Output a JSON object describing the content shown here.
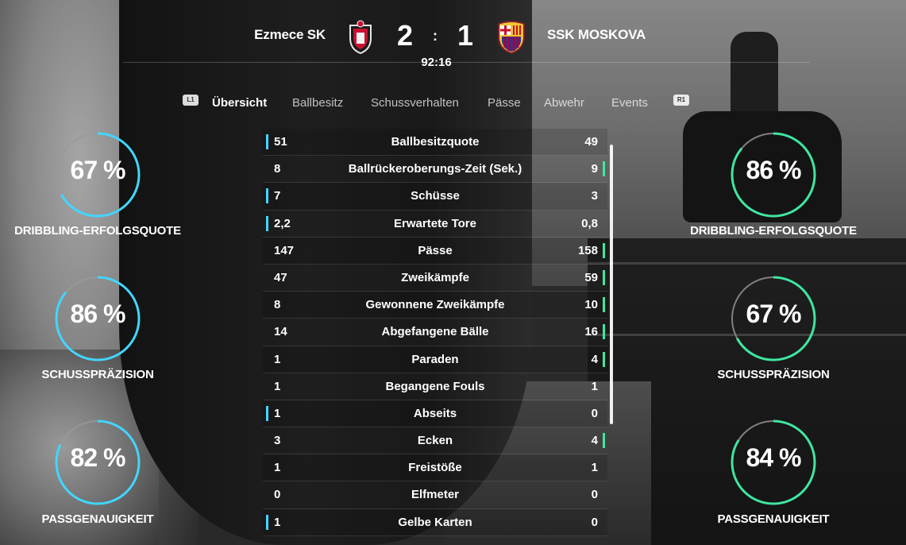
{
  "scoreboard": {
    "home_team": "Ezmece SK",
    "away_team": "SSK MOSKOVA",
    "home_score": "2",
    "away_score": "1",
    "separator": ":",
    "match_time": "92:16"
  },
  "tabs": {
    "left_shoulder": "L1",
    "right_shoulder": "R1",
    "items": [
      "Übersicht",
      "Ballbesitz",
      "Schussverhalten",
      "Pässe",
      "Abwehr",
      "Events"
    ],
    "active_index": 0
  },
  "stats": [
    {
      "home": "51",
      "name": "Ballbesitzquote",
      "away": "49",
      "leader": "home"
    },
    {
      "home": "8",
      "name": "Ballrückeroberungs-Zeit (Sek.)",
      "away": "9",
      "leader": "away"
    },
    {
      "home": "7",
      "name": "Schüsse",
      "away": "3",
      "leader": "home"
    },
    {
      "home": "2,2",
      "name": "Erwartete Tore",
      "away": "0,8",
      "leader": "home"
    },
    {
      "home": "147",
      "name": "Pässe",
      "away": "158",
      "leader": "away"
    },
    {
      "home": "47",
      "name": "Zweikämpfe",
      "away": "59",
      "leader": "away"
    },
    {
      "home": "8",
      "name": "Gewonnene Zweikämpfe",
      "away": "10",
      "leader": "away"
    },
    {
      "home": "14",
      "name": "Abgefangene Bälle",
      "away": "16",
      "leader": "away"
    },
    {
      "home": "1",
      "name": "Paraden",
      "away": "4",
      "leader": "away"
    },
    {
      "home": "1",
      "name": "Begangene Fouls",
      "away": "1",
      "leader": "none"
    },
    {
      "home": "1",
      "name": "Abseits",
      "away": "0",
      "leader": "home"
    },
    {
      "home": "3",
      "name": "Ecken",
      "away": "4",
      "leader": "away"
    },
    {
      "home": "1",
      "name": "Freistöße",
      "away": "1",
      "leader": "none"
    },
    {
      "home": "0",
      "name": "Elfmeter",
      "away": "0",
      "leader": "none"
    },
    {
      "home": "1",
      "name": "Gelbe Karten",
      "away": "0",
      "leader": "home"
    }
  ],
  "home_rings": [
    {
      "value": "67 %",
      "fraction": 0.67,
      "label": "DRIBBLING-ERFOLGSQUOTE"
    },
    {
      "value": "86 %",
      "fraction": 0.86,
      "label": "SCHUSSPRÄZISION"
    },
    {
      "value": "82 %",
      "fraction": 0.82,
      "label": "PASSGENAUIGKEIT"
    }
  ],
  "away_rings": [
    {
      "value": "86 %",
      "fraction": 0.86,
      "label": "DRIBBLING-ERFOLGSQUOTE"
    },
    {
      "value": "67 %",
      "fraction": 0.67,
      "label": "SCHUSSPRÄZISION"
    },
    {
      "value": "84 %",
      "fraction": 0.84,
      "label": "PASSGENAUIGKEIT"
    }
  ],
  "colors": {
    "home_accent": "#42d6ff",
    "away_accent": "#3fe6a0",
    "ring_track": "#9a9a9a"
  }
}
